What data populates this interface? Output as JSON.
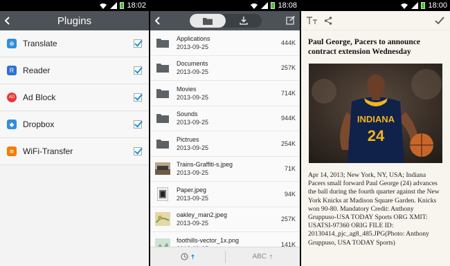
{
  "status_bars": [
    {
      "time": "18:02"
    },
    {
      "time": "18:08"
    },
    {
      "time": "18:00"
    }
  ],
  "plugins_panel": {
    "title": "Plugins",
    "items": [
      {
        "label": "Translate",
        "icon": "translate-icon",
        "color": "#2d8fd8",
        "glyph": "⊕",
        "checked": true
      },
      {
        "label": "Reader",
        "icon": "reader-icon",
        "color": "#2d6fd8",
        "glyph": "R",
        "checked": true
      },
      {
        "label": "Ad Block",
        "icon": "adblock-icon",
        "color": "#e53935",
        "glyph": "AD",
        "checked": true
      },
      {
        "label": "Dropbox",
        "icon": "dropbox-icon",
        "color": "#2f8de0",
        "glyph": "◆",
        "checked": true
      },
      {
        "label": "WiFi-Transfer",
        "icon": "wifi-transfer-icon",
        "color": "#f57c00",
        "glyph": "≋",
        "checked": true
      }
    ]
  },
  "files_panel": {
    "tabs": [
      {
        "name": "folder-tab",
        "icon": "folder-icon",
        "active": true
      },
      {
        "name": "download-tab",
        "icon": "download-icon",
        "active": false
      }
    ],
    "files": [
      {
        "name": "Applications",
        "date": "2013-09-25",
        "size": "444K",
        "thumb": "folder"
      },
      {
        "name": "Documents",
        "date": "2013-09-25",
        "size": "257K",
        "thumb": "folder"
      },
      {
        "name": "Movies",
        "date": "2013-09-25",
        "size": "714K",
        "thumb": "folder"
      },
      {
        "name": "Sounds",
        "date": "2013-09-25",
        "size": "944K",
        "thumb": "folder"
      },
      {
        "name": "Pictrues",
        "date": "2013-09-25",
        "size": "254K",
        "thumb": "folder"
      },
      {
        "name": "Trains-Graffiti-s.jpeg",
        "date": "2013-09-25",
        "size": "71K",
        "thumb": "image-train"
      },
      {
        "name": "Paper.jpeg",
        "date": "2013-09-25",
        "size": "94K",
        "thumb": "image-paper"
      },
      {
        "name": "oakley_man2.jpeg",
        "date": "2013-09-25",
        "size": "257K",
        "thumb": "image-map"
      },
      {
        "name": "foothills-vector_1x.png",
        "date": "2013-09-25",
        "size": "141K",
        "thumb": "image-foothills"
      }
    ],
    "bottom_bar": {
      "sort_time_icon": "clock-icon",
      "sort_abc_label": "ABC"
    }
  },
  "article_panel": {
    "headline": "Paul George, Pacers to announce contract extension Wednesday",
    "photo": {
      "jersey_text": "INDIANA",
      "jersey_number": "24"
    },
    "body": "Apr 14, 2013; New York, NY, USA; Indiana Pacers small forward Paul George (24) advances the ball during the fourth quarter against the New York Knicks at Madison Square Garden. Knicks won 90-80. Mandatory Credit: Anthony Gruppuso-USA TODAY Sports ORG XMIT: USATSI-97360 ORIG FILE ID: 20130414_pjc_ag8_485.JPG(Photo: Anthony Gruppuso, USA TODAY Sports)"
  }
}
